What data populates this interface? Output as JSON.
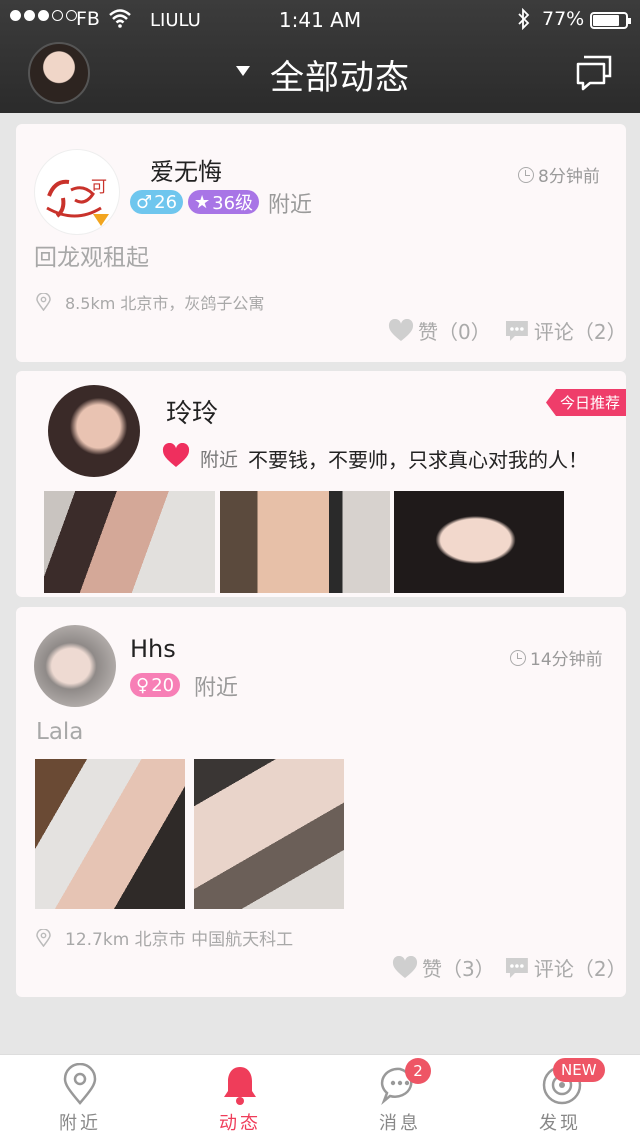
{
  "status_bar": {
    "carrier": "FB",
    "app": "LIULU",
    "time": "1:41 AM",
    "battery": "77%"
  },
  "header": {
    "title": "全部动态"
  },
  "posts": [
    {
      "username": "爱无悔",
      "time": "8分钟前",
      "gender_age": "26",
      "level": "36级",
      "distance_tag": "附近",
      "text": "回龙观租起",
      "distance": "8.5km",
      "location": "北京市，灰鸽子公寓",
      "like_label": "赞（0）",
      "comment_label": "评论（2）"
    },
    {
      "username": "玲玲",
      "badge": "今日推荐",
      "distance_tag": "附近",
      "text": "不要钱，不要帅，只求真心对我的人！"
    },
    {
      "username": "Hhs",
      "time": "14分钟前",
      "gender_age": "20",
      "distance_tag": "附近",
      "text": "Lala",
      "distance": "12.7km",
      "city": "北京市",
      "location": "中国航天科工",
      "like_label": "赞（3）",
      "comment_label": "评论（2）"
    }
  ],
  "tabs": [
    {
      "label": "附近",
      "icon": "location-pin-icon"
    },
    {
      "label": "动态",
      "icon": "bell-icon",
      "active": true
    },
    {
      "label": "消息",
      "icon": "chat-bubble-icon",
      "badge": "2"
    },
    {
      "label": "发现",
      "icon": "compass-icon",
      "badge": "NEW"
    }
  ],
  "colors": {
    "accent": "#ef3d5a",
    "header_bg": "#2f2f2f",
    "card_bg": "#fdf8f9"
  }
}
